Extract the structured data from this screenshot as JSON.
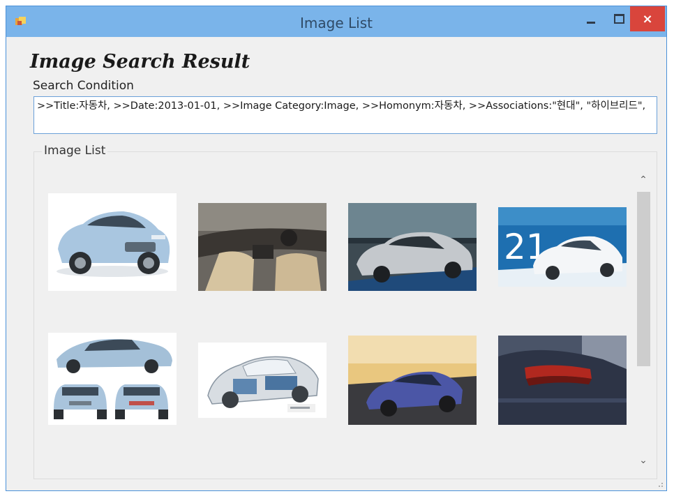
{
  "window": {
    "title": "Image List",
    "icon": "app-icon",
    "controls": {
      "minimize": "minimize-icon",
      "maximize": "maximize-icon",
      "close": "close-icon"
    },
    "close_symbol": "×"
  },
  "main": {
    "heading": "Image Search Result",
    "search_condition_label": "Search Condition",
    "search_condition_text": ">>Title:자동차, >>Date:2013-01-01, >>Image Category:Image, >>Homonym:자동차, >>Associations:\"현대\", \"하이브리드\",",
    "image_list_label": "Image List"
  },
  "images": [
    {
      "name": "thumb-1",
      "desc": "light blue sedan front three-quarter view on white",
      "overlay_text": ""
    },
    {
      "name": "thumb-2",
      "desc": "car interior dashboard beige seats",
      "overlay_text": ""
    },
    {
      "name": "thumb-3",
      "desc": "silver sedan in showroom",
      "overlay_text": ""
    },
    {
      "name": "thumb-4",
      "desc": "white car on blue advertisement",
      "overlay_text": "21"
    },
    {
      "name": "thumb-5",
      "desc": "blue car side, front and rear views",
      "overlay_text": ""
    },
    {
      "name": "thumb-6",
      "desc": "cutaway hybrid car illustration",
      "overlay_text": ""
    },
    {
      "name": "thumb-7",
      "desc": "blue sedan driving on road at sunset",
      "overlay_text": ""
    },
    {
      "name": "thumb-8",
      "desc": "dark car rear tail light close-up",
      "overlay_text": ""
    }
  ],
  "scrollbar": {
    "up_symbol": "⌃",
    "down_symbol": "⌄"
  },
  "colors": {
    "titlebar": "#7ab4ea",
    "close": "#d9453c",
    "border": "#4a90d9"
  }
}
